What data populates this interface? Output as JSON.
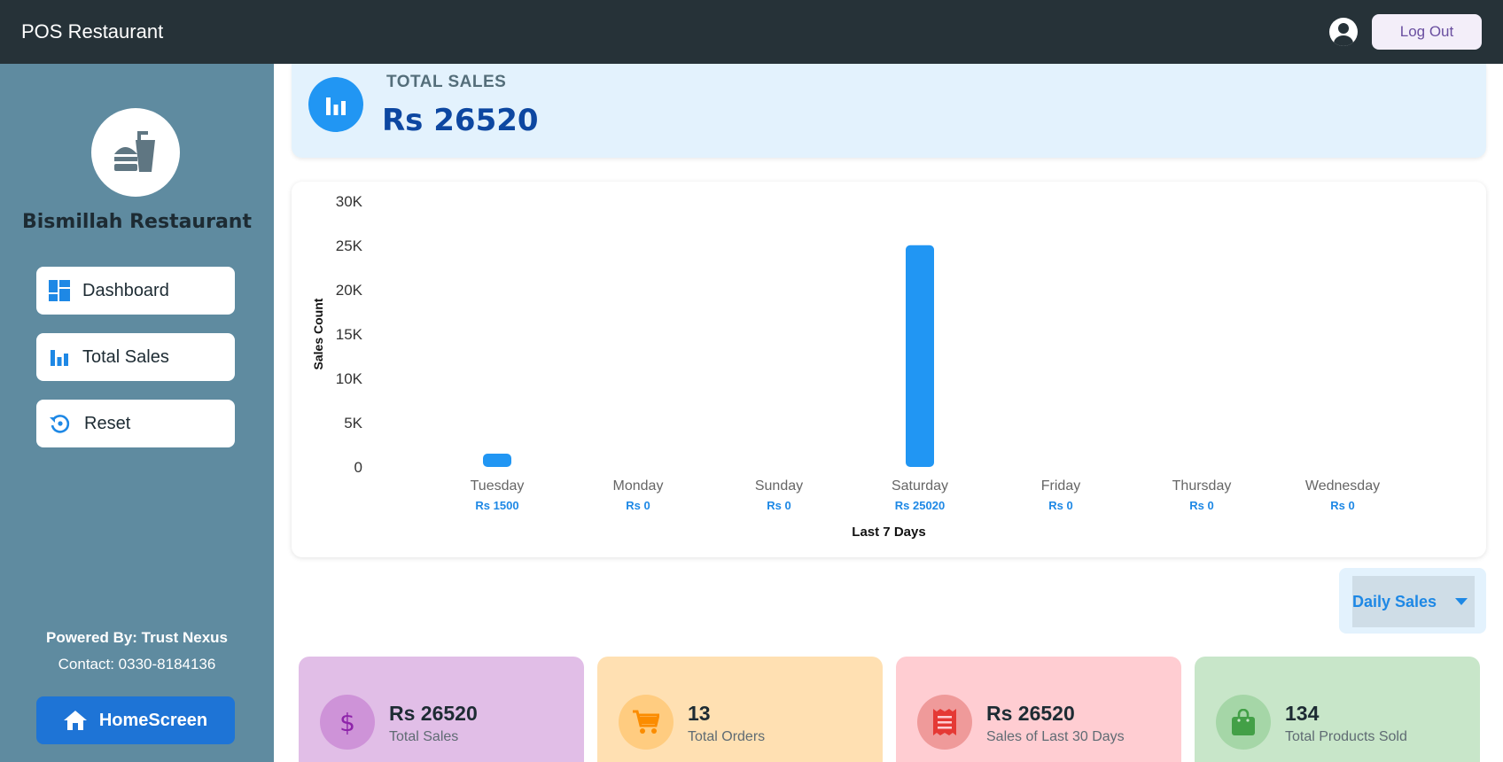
{
  "header": {
    "app_title": "POS Restaurant",
    "logout_label": "Log Out"
  },
  "sidebar": {
    "restaurant_name": "Bismillah Restaurant",
    "items": [
      {
        "label": "Dashboard",
        "icon": "dashboard-icon"
      },
      {
        "label": "Total Sales",
        "icon": "bar-chart-icon"
      },
      {
        "label": "Reset",
        "icon": "reset-icon"
      }
    ],
    "powered_by": "Powered By: Trust Nexus",
    "contact": "Contact: 0330-8184136",
    "home_label": "HomeScreen"
  },
  "summary": {
    "label": "TOTAL SALES",
    "value": "Rs 26520"
  },
  "chart_data": {
    "type": "bar",
    "categories": [
      "Tuesday",
      "Monday",
      "Sunday",
      "Saturday",
      "Friday",
      "Thursday",
      "Wednesday"
    ],
    "values": [
      1500,
      0,
      0,
      25020,
      0,
      0,
      0
    ],
    "value_labels": [
      "Rs 1500",
      "Rs 0",
      "Rs 0",
      "Rs 25020",
      "Rs 0",
      "Rs 0",
      "Rs 0"
    ],
    "y_ticks": [
      "0",
      "5K",
      "10K",
      "15K",
      "20K",
      "25K",
      "30K"
    ],
    "ylim": [
      0,
      30000
    ],
    "xlabel": "Last 7 Days",
    "ylabel": "Sales Count",
    "bar_color": "#2196f3",
    "grid": false
  },
  "filter": {
    "selected": "Daily Sales"
  },
  "stats": [
    {
      "value": "Rs 26520",
      "label": "Total Sales",
      "icon": "dollar-icon",
      "bg": "#e1bee7",
      "icon_bg": "#ce93d8",
      "icon_color": "#8e24aa"
    },
    {
      "value": "13",
      "label": "Total Orders",
      "icon": "cart-icon",
      "bg": "#ffe0b2",
      "icon_bg": "#ffcc80",
      "icon_color": "#fb8c00"
    },
    {
      "value": "Rs 26520",
      "label": "Sales of Last 30 Days",
      "icon": "receipt-icon",
      "bg": "#ffcdd2",
      "icon_bg": "#ef9a9a",
      "icon_color": "#e53935"
    },
    {
      "value": "134",
      "label": "Total Products Sold",
      "icon": "shopping-bag-icon",
      "bg": "#c8e6c9",
      "icon_bg": "#a5d6a7",
      "icon_color": "#43a047"
    }
  ]
}
